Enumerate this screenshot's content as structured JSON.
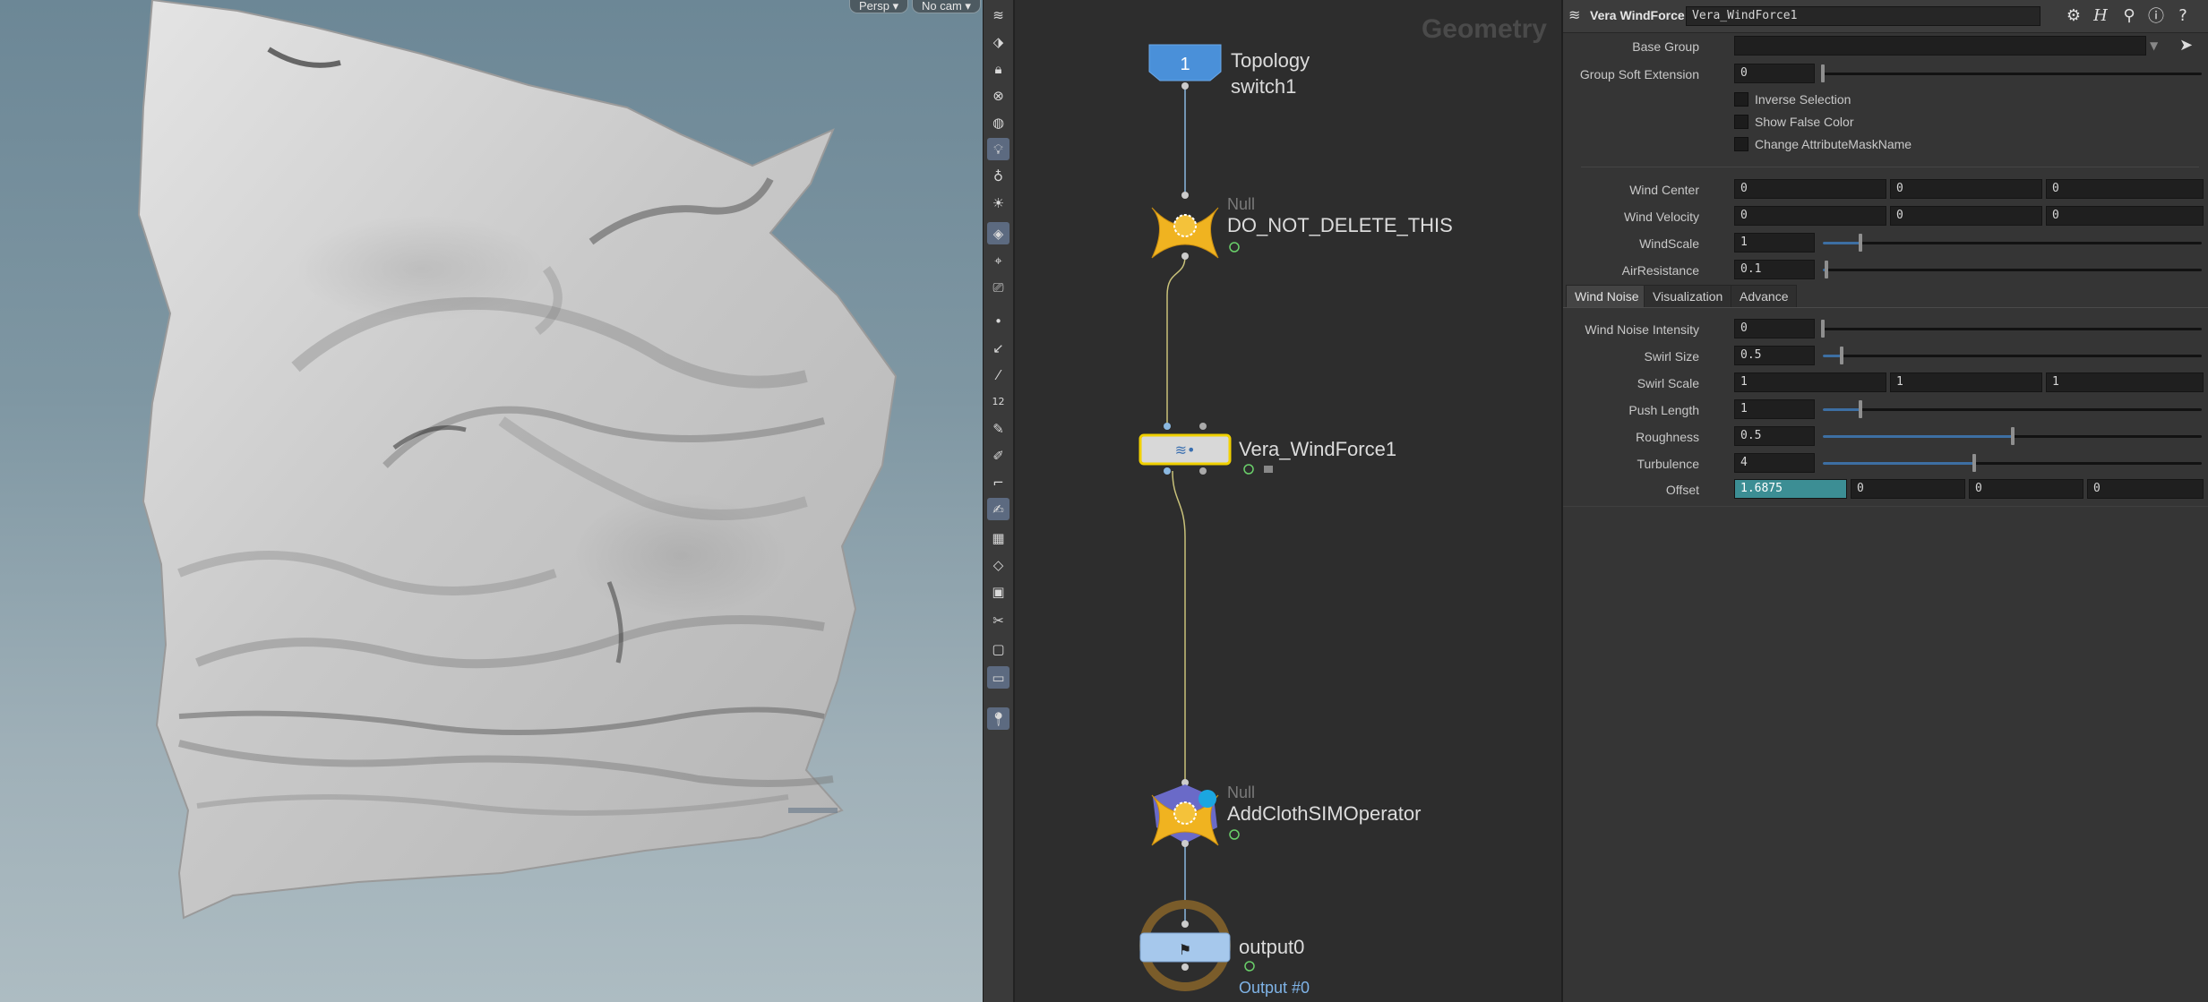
{
  "viewport": {
    "camera_menu": "Persp",
    "cam_menu": "No cam"
  },
  "toolbar": {
    "tools": [
      "handle-tool",
      "view-tool",
      "lock-tool",
      "clear-tool",
      "sphere-tool",
      "light-tool",
      "light2-tool",
      "light3-tool",
      "material-tool",
      "camera-tool",
      "camera2-tool",
      "point-tool",
      "brush-tool",
      "pin-tool",
      "number-tool",
      "sculpt-tool",
      "paint-tool",
      "curve-tool",
      "draw-tool",
      "texture-tool",
      "grid-tool",
      "image-tool",
      "cut-tool",
      "stop-tool",
      "render-tool",
      "pin2-tool"
    ],
    "badge_12": "12"
  },
  "network": {
    "context_label": "Geometry",
    "nodes": [
      {
        "name": "Topology",
        "name2": "switch1",
        "badge": "1"
      },
      {
        "type": "Null",
        "name": "DO_NOT_DELETE_THIS"
      },
      {
        "name": "Vera_WindForce1"
      },
      {
        "type": "Null",
        "name": "AddClothSIMOperator"
      },
      {
        "name": "output0",
        "sub": "Output #0"
      }
    ]
  },
  "params": {
    "header": {
      "node_type": "Vera WindForce",
      "node_name": "Vera_WindForce1"
    },
    "base_group": {
      "label": "Base Group",
      "value": ""
    },
    "group_soft_extension": {
      "label": "Group Soft Extension",
      "value": "0",
      "level": 0
    },
    "checkboxes": [
      {
        "label": "Inverse Selection",
        "checked": false
      },
      {
        "label": "Show False Color",
        "checked": false
      },
      {
        "label": "Change AttributeMaskName",
        "checked": false
      }
    ],
    "wind_center": {
      "label": "Wind Center",
      "values": [
        "0",
        "0",
        "0"
      ]
    },
    "wind_velocity": {
      "label": "Wind Velocity",
      "values": [
        "0",
        "0",
        "0"
      ]
    },
    "windscale": {
      "label": "WindScale",
      "value": "1",
      "level": 0.1
    },
    "airresistance": {
      "label": "AirResistance",
      "value": "0.1",
      "level": 0.01
    },
    "tabs": [
      {
        "label": "Wind Noise",
        "active": true
      },
      {
        "label": "Visualization",
        "active": false
      },
      {
        "label": "Advance",
        "active": false
      }
    ],
    "wind_noise_intensity": {
      "label": "Wind Noise Intensity",
      "value": "0",
      "level": 0
    },
    "swirl_size": {
      "label": "Swirl Size",
      "value": "0.5",
      "level": 0.05
    },
    "swirl_scale": {
      "label": "Swirl Scale",
      "values": [
        "1",
        "1",
        "1"
      ]
    },
    "push_length": {
      "label": "Push Length",
      "value": "1",
      "level": 0.1
    },
    "roughness": {
      "label": "Roughness",
      "value": "0.5",
      "level": 0.5
    },
    "turbulence": {
      "label": "Turbulence",
      "value": "4",
      "level": 0.4
    },
    "offset": {
      "label": "Offset",
      "values": [
        "1.6875",
        "0",
        "0",
        "0"
      ]
    }
  }
}
